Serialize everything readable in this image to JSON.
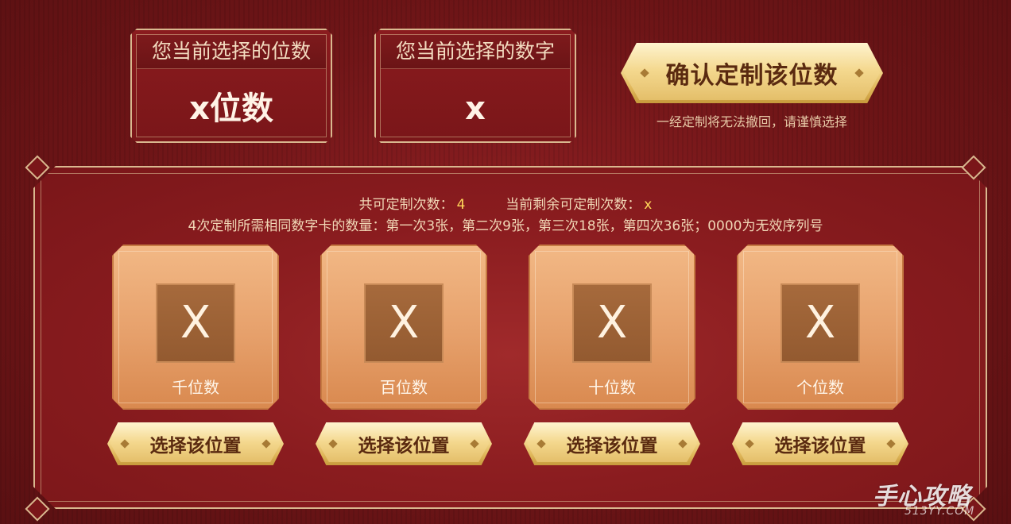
{
  "selected_digits_box": {
    "title": "您当前选择的位数",
    "value": "x位数"
  },
  "selected_number_box": {
    "title": "您当前选择的数字",
    "value": "x"
  },
  "confirm_button": {
    "label": "确认定制该位数"
  },
  "warning_text": "一经定制将无法撤回，请谨慎选择",
  "stats": {
    "total_label": "共可定制次数：",
    "total_value": "4",
    "remaining_label": "当前剩余可定制次数：",
    "remaining_value": "x"
  },
  "rule_text": "4次定制所需相同数字卡的数量：第一次3张，第二次9张，第三次18张，第四次36张；0000为无效序列号",
  "positions": [
    {
      "digit": "X",
      "label": "千位数",
      "button": "选择该位置"
    },
    {
      "digit": "X",
      "label": "百位数",
      "button": "选择该位置"
    },
    {
      "digit": "X",
      "label": "十位数",
      "button": "选择该位置"
    },
    {
      "digit": "X",
      "label": "个位数",
      "button": "选择该位置"
    }
  ],
  "watermark": {
    "main": "手心攻略",
    "sub": "513YY.COM"
  },
  "colors": {
    "background": "#7a1619",
    "gold": "#f4d88e",
    "card": "#e6a06b",
    "highlight": "#ffd75a"
  }
}
